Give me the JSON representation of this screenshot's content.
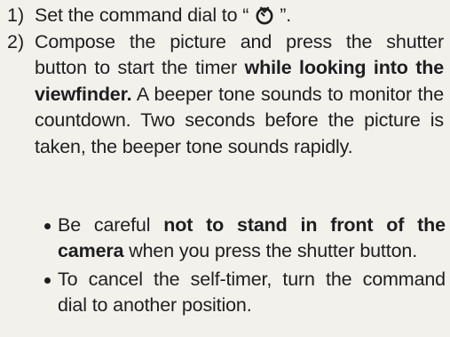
{
  "step1": {
    "number": "1)",
    "text_before": "Set the command dial to “",
    "icon": "self-timer-icon",
    "text_after": "”."
  },
  "step2": {
    "number": "2)",
    "text_part1": "Compose the picture and press the shut­ter button to start the timer ",
    "bold1": "while look­ing into the viewfinder.",
    "text_part2": " A beeper tone sounds to monitor the countdown. Two seconds before the picture is taken, the beeper tone sounds rapidly."
  },
  "bullets": {
    "item1": {
      "text_part1": "Be careful ",
      "bold": "not to stand in front of the camera",
      "text_part2": " when you press the shut­ter button."
    },
    "item2": {
      "text": "To cancel the self-timer, turn the command dial to another position."
    }
  }
}
